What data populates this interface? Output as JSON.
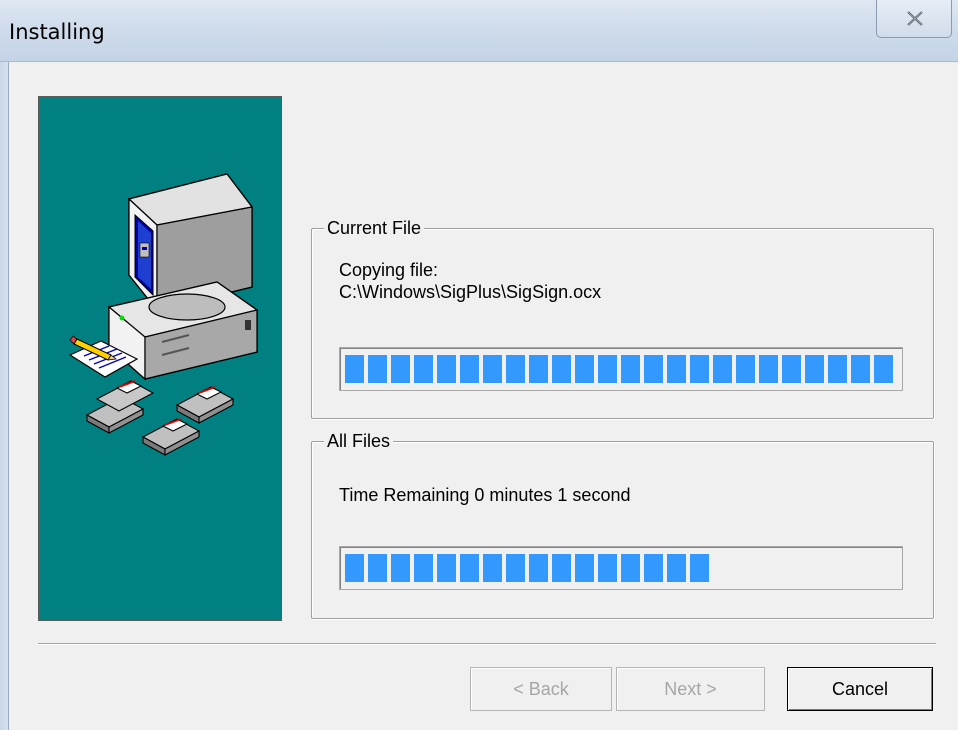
{
  "window": {
    "title": "Installing",
    "close_glyph": "✕"
  },
  "current_file": {
    "group_label": "Current File",
    "status_line": "Copying file:",
    "file_path": "C:\\Windows\\SigPlus\\SigSign.ocx",
    "progress": 1.0
  },
  "all_files": {
    "group_label": "All Files",
    "time_remaining": "Time Remaining 0 minutes 1 second",
    "progress": 0.69
  },
  "buttons": {
    "back": "< Back",
    "next": "Next >",
    "cancel": "Cancel",
    "back_enabled": false,
    "next_enabled": false,
    "cancel_enabled": true
  },
  "colors": {
    "banner_background": "#008080",
    "progress_fill": "#3399ff",
    "dialog_background": "#f0f0f0"
  },
  "icons": {
    "banner": "computer-install-illustration",
    "close": "close-icon"
  }
}
